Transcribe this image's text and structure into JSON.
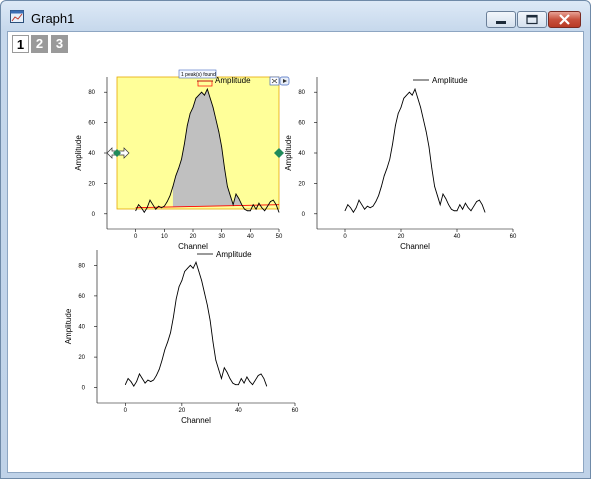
{
  "window": {
    "title": "Graph1",
    "buttons": [
      "minimize",
      "maximize",
      "close"
    ],
    "icons": {
      "app": "graph-window-icon"
    }
  },
  "layer_tabs": [
    {
      "label": "1",
      "active": true
    },
    {
      "label": "2",
      "active": false
    },
    {
      "label": "3",
      "active": false
    }
  ],
  "colors": {
    "highlight_fill": "#ffff99",
    "peak_fill": "#c0c0c0",
    "baseline": "#ff0000",
    "marker": "#008000",
    "frame": "#000000"
  },
  "badge": {
    "text": "1 peak(s) found"
  },
  "chart_data": [
    {
      "type": "line",
      "panel": "top-left",
      "highlighted": true,
      "xlabel": "Channel",
      "ylabel": "Amplitude",
      "xlim": [
        -10,
        50
      ],
      "ylim": [
        -10,
        90
      ],
      "xticks": [
        "0",
        "10",
        "20",
        "30",
        "40",
        "50"
      ],
      "yticks": [
        "0",
        "20",
        "40",
        "60",
        "80"
      ],
      "legend": "top-right",
      "series": [
        {
          "name": "Amplitude",
          "color": "#000000"
        }
      ],
      "x": [
        0,
        1,
        2,
        3,
        4,
        5,
        6,
        7,
        8,
        9,
        10,
        11,
        12,
        13,
        14,
        15,
        16,
        17,
        18,
        19,
        20,
        21,
        22,
        23,
        24,
        25,
        26,
        27,
        28,
        29,
        30,
        31,
        32,
        33,
        34,
        35,
        36,
        37,
        38,
        39,
        40,
        41,
        42,
        43,
        44,
        45,
        46,
        47,
        48,
        49,
        50
      ],
      "y": [
        2,
        6,
        4,
        1,
        4,
        9,
        6,
        3,
        5,
        4,
        5,
        8,
        12,
        18,
        25,
        30,
        36,
        46,
        58,
        66,
        70,
        76,
        78,
        80,
        78,
        82,
        76,
        70,
        62,
        54,
        44,
        30,
        18,
        12,
        6,
        13,
        10,
        6,
        3,
        2,
        2,
        6,
        3,
        7,
        4,
        2,
        5,
        8,
        9,
        6,
        1
      ],
      "peak": {
        "x": 25,
        "y": 82
      },
      "baseline": {
        "x": [
          0,
          50
        ],
        "y": [
          4,
          6
        ]
      }
    },
    {
      "type": "line",
      "panel": "top-right",
      "xlabel": "Channel",
      "ylabel": "Amplitude",
      "xlim": [
        -10,
        60
      ],
      "ylim": [
        -10,
        90
      ],
      "xticks": [
        "0",
        "20",
        "40",
        "60"
      ],
      "yticks": [
        "0",
        "20",
        "40",
        "60",
        "80"
      ],
      "legend": "top-right",
      "series": [
        {
          "name": "Amplitude",
          "color": "#000000"
        }
      ],
      "x": [
        0,
        1,
        2,
        3,
        4,
        5,
        6,
        7,
        8,
        9,
        10,
        11,
        12,
        13,
        14,
        15,
        16,
        17,
        18,
        19,
        20,
        21,
        22,
        23,
        24,
        25,
        26,
        27,
        28,
        29,
        30,
        31,
        32,
        33,
        34,
        35,
        36,
        37,
        38,
        39,
        40,
        41,
        42,
        43,
        44,
        45,
        46,
        47,
        48,
        49,
        50
      ],
      "y": [
        2,
        6,
        4,
        1,
        4,
        9,
        6,
        3,
        5,
        4,
        5,
        8,
        12,
        18,
        25,
        30,
        36,
        46,
        58,
        66,
        70,
        76,
        78,
        80,
        78,
        82,
        76,
        70,
        62,
        54,
        44,
        30,
        18,
        12,
        6,
        13,
        10,
        6,
        3,
        2,
        2,
        6,
        3,
        7,
        4,
        2,
        5,
        8,
        9,
        6,
        1
      ]
    },
    {
      "type": "line",
      "panel": "bottom-left",
      "xlabel": "Channel",
      "ylabel": "Amplitude",
      "xlim": [
        -10,
        60
      ],
      "ylim": [
        -10,
        90
      ],
      "xticks": [
        "0",
        "20",
        "40",
        "60"
      ],
      "yticks": [
        "0",
        "20",
        "40",
        "60",
        "80"
      ],
      "legend": "top-right",
      "series": [
        {
          "name": "Amplitude",
          "color": "#000000"
        }
      ],
      "x": [
        0,
        1,
        2,
        3,
        4,
        5,
        6,
        7,
        8,
        9,
        10,
        11,
        12,
        13,
        14,
        15,
        16,
        17,
        18,
        19,
        20,
        21,
        22,
        23,
        24,
        25,
        26,
        27,
        28,
        29,
        30,
        31,
        32,
        33,
        34,
        35,
        36,
        37,
        38,
        39,
        40,
        41,
        42,
        43,
        44,
        45,
        46,
        47,
        48,
        49,
        50
      ],
      "y": [
        2,
        6,
        4,
        1,
        4,
        9,
        6,
        3,
        5,
        4,
        5,
        8,
        12,
        18,
        25,
        30,
        36,
        46,
        58,
        66,
        70,
        76,
        78,
        80,
        78,
        82,
        76,
        70,
        62,
        54,
        44,
        30,
        18,
        12,
        6,
        13,
        10,
        6,
        3,
        2,
        2,
        6,
        3,
        7,
        4,
        2,
        5,
        8,
        9,
        6,
        1
      ]
    }
  ]
}
